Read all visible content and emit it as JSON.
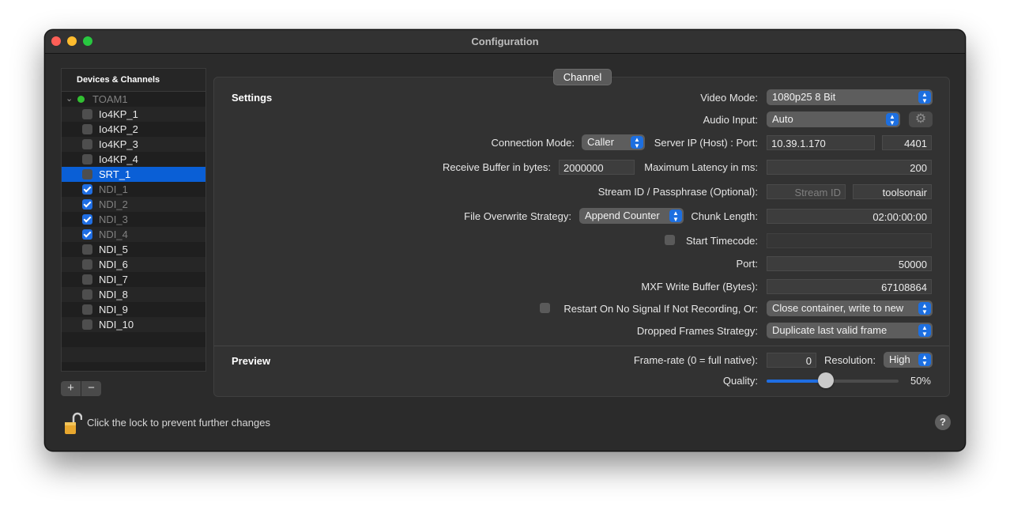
{
  "window": {
    "title": "Configuration"
  },
  "sidebar": {
    "header": "Devices & Channels",
    "group": "TOAM1",
    "items": [
      {
        "label": "Io4KP_1",
        "checked": false,
        "dim": false,
        "selected": false
      },
      {
        "label": "Io4KP_2",
        "checked": false,
        "dim": false,
        "selected": false
      },
      {
        "label": "Io4KP_3",
        "checked": false,
        "dim": false,
        "selected": false
      },
      {
        "label": "Io4KP_4",
        "checked": false,
        "dim": false,
        "selected": false
      },
      {
        "label": "SRT_1",
        "checked": false,
        "dim": false,
        "selected": true
      },
      {
        "label": "NDI_1",
        "checked": true,
        "dim": true,
        "selected": false
      },
      {
        "label": "NDI_2",
        "checked": true,
        "dim": true,
        "selected": false
      },
      {
        "label": "NDI_3",
        "checked": true,
        "dim": true,
        "selected": false
      },
      {
        "label": "NDI_4",
        "checked": true,
        "dim": true,
        "selected": false
      },
      {
        "label": "NDI_5",
        "checked": false,
        "dim": false,
        "selected": false
      },
      {
        "label": "NDI_6",
        "checked": false,
        "dim": false,
        "selected": false
      },
      {
        "label": "NDI_7",
        "checked": false,
        "dim": false,
        "selected": false
      },
      {
        "label": "NDI_8",
        "checked": false,
        "dim": false,
        "selected": false
      },
      {
        "label": "NDI_9",
        "checked": false,
        "dim": false,
        "selected": false
      },
      {
        "label": "NDI_10",
        "checked": false,
        "dim": false,
        "selected": false
      }
    ],
    "add_label": "+",
    "remove_label": "−"
  },
  "tab": {
    "label": "Channel"
  },
  "settings": {
    "title": "Settings",
    "video_mode_label": "Video Mode:",
    "video_mode_value": "1080p25 8 Bit",
    "audio_input_label": "Audio Input:",
    "audio_input_value": "Auto",
    "connection_mode_label": "Connection Mode:",
    "connection_mode_value": "Caller",
    "server_ip_label": "Server IP (Host) : Port:",
    "server_ip_value": "10.39.1.170",
    "server_port_value": "4401",
    "receive_buffer_label": "Receive Buffer in bytes:",
    "receive_buffer_value": "2000000",
    "max_latency_label": "Maximum Latency in ms:",
    "max_latency_value": "200",
    "stream_id_label": "Stream ID / Passphrase (Optional):",
    "stream_id_placeholder": "Stream ID",
    "passphrase_value": "toolsonair",
    "overwrite_label": "File Overwrite Strategy:",
    "overwrite_value": "Append Counter",
    "chunk_length_label": "Chunk Length:",
    "chunk_length_value": "02:00:00:00",
    "start_timecode_label": "Start Timecode:",
    "start_timecode_value": "",
    "port_label": "Port:",
    "port_value": "50000",
    "mxf_buffer_label": "MXF Write Buffer (Bytes):",
    "mxf_buffer_value": "67108864",
    "restart_label": "Restart On No Signal If Not Recording, Or:",
    "restart_value": "Close container, write to new",
    "dropped_frames_label": "Dropped Frames Strategy:",
    "dropped_frames_value": "Duplicate last valid frame"
  },
  "preview": {
    "title": "Preview",
    "framerate_label": "Frame-rate (0 = full native):",
    "framerate_value": "0",
    "resolution_label": "Resolution:",
    "resolution_value": "High",
    "quality_label": "Quality:",
    "quality_value": "50%",
    "quality_fraction": 0.5
  },
  "footer": {
    "lock_text": "Click the lock to prevent further changes",
    "help_label": "?"
  },
  "colors": {
    "accent": "#1f6ee3",
    "selection": "#0a5fd6",
    "status_green": "#32c032"
  }
}
